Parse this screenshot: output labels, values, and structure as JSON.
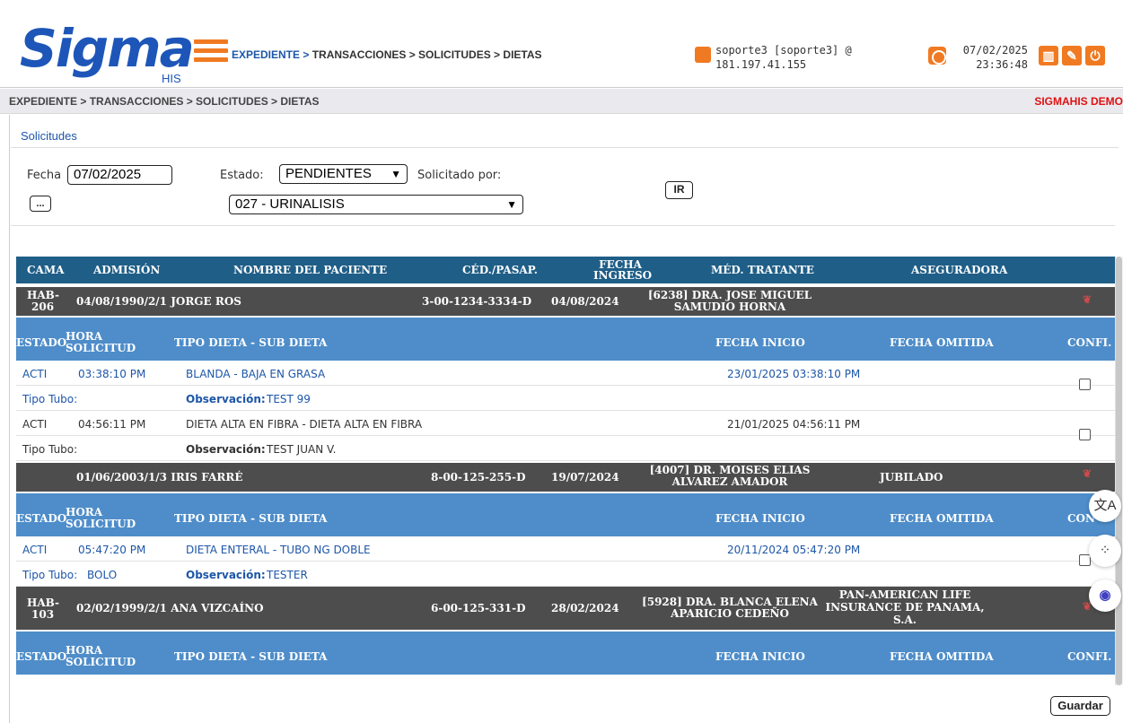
{
  "header": {
    "logo_text": "Sigma",
    "logo_sub": "HIS",
    "breadcrumb_prefix": "EXPEDIENTE > ",
    "breadcrumb_rest": "TRANSACCIONES > SOLICITUDES > DIETAS",
    "user_line1": "soporte3 [soporte3] @",
    "user_line2": "181.197.41.155",
    "date": "07/02/2025",
    "time": "23:36:48"
  },
  "subbar": {
    "breadcrumb": "EXPEDIENTE > TRANSACCIONES > SOLICITUDES > DIETAS",
    "demo_label": "SIGMAHIS DEMO"
  },
  "form": {
    "section_title": "Solicitudes",
    "fecha_label": "Fecha",
    "fecha_value": "07/02/2025",
    "dots_button": "...",
    "estado_label": "Estado:",
    "estado_value": "PENDIENTES",
    "solicitado_label": "Solicitado por:",
    "solicitado_value": "027 - URINALISIS",
    "ir_button": "IR"
  },
  "grid": {
    "headers": {
      "cama": "CAMA",
      "admision": "ADMISIÓN",
      "nombre": "NOMBRE DEL PACIENTE",
      "ced": "CÉD./PASAP.",
      "fecha_ingreso_1": "FECHA",
      "fecha_ingreso_2": "INGRESO",
      "medico": "MÉD. TRATANTE",
      "aseguradora": "ASEGURADORA"
    },
    "sub_headers": {
      "estado": "ESTADO",
      "hora_1": "HORA",
      "hora_2": "SOLICITUD",
      "tipo": "TIPO DIETA - SUB DIETA",
      "fecha_inicio": "FECHA INICIO",
      "fecha_omitida": "FECHA OMITIDA",
      "confirm_full": "CONFI.",
      "confirm_cut": "CON"
    },
    "tipo_tubo_label": "Tipo Tubo:",
    "observacion_label": "Observación:",
    "patients": [
      {
        "cama_1": "HAB-",
        "cama_2": "206",
        "admision_nombre": "04/08/1990/2/1 JORGE ROS",
        "ced": "3-00-1234-3334-D",
        "fecha_ingreso": "04/08/2024",
        "medico_1": "[6238] DRA. JOSE MIGUEL",
        "medico_2": "SAMUDIO HORNA",
        "aseguradora_1": "",
        "aseguradora_2": "",
        "aseguradora_3": "",
        "rows": [
          {
            "estado": "ACTI",
            "hora": "03:38:10 PM",
            "tipo": "BLANDA - BAJA EN GRASA",
            "fecha_inicio": "23/01/2025 03:38:10 PM",
            "tubo": "",
            "observacion": "TEST 99"
          },
          {
            "estado": "ACTI",
            "hora": "04:56:11 PM",
            "tipo": "DIETA ALTA EN FIBRA - DIETA ALTA EN FIBRA",
            "fecha_inicio": "21/01/2025 04:56:11 PM",
            "tubo": "",
            "observacion": "TEST JUAN V."
          }
        ]
      },
      {
        "cama_1": "",
        "cama_2": "",
        "admision_nombre": "01/06/2003/1/3 IRIS FARRÉ",
        "ced": "8-00-125-255-D",
        "fecha_ingreso": "19/07/2024",
        "medico_1": "[4007] DR. MOISES ELIAS",
        "medico_2": "ALVAREZ AMADOR",
        "aseguradora_1": "JUBILADO",
        "aseguradora_2": "",
        "aseguradora_3": "",
        "rows": [
          {
            "estado": "ACTI",
            "hora": "05:47:20 PM",
            "tipo": "DIETA ENTERAL - TUBO NG DOBLE",
            "fecha_inicio": "20/11/2024 05:47:20 PM",
            "tubo": "BOLO",
            "observacion": "TESTER"
          }
        ]
      },
      {
        "cama_1": "HAB-",
        "cama_2": "103",
        "admision_nombre": "02/02/1999/2/1 ANA VIZCAÍNO",
        "ced": "6-00-125-331-D",
        "fecha_ingreso": "28/02/2024",
        "medico_1": "[5928] DRA. BLANCA ELENA",
        "medico_2": "APARICIO CEDEÑO",
        "aseguradora_1": "PAN-AMERICAN LIFE",
        "aseguradora_2": "INSURANCE DE PANAMA,",
        "aseguradora_3": "S.A.",
        "rows": []
      }
    ]
  },
  "footer": {
    "save_button": "Guardar"
  },
  "colors": {
    "brand_blue": "#1d56b8",
    "accent_orange": "#f07a22",
    "grid_header": "#1f5e87",
    "patient_row": "#4d4d4d",
    "sub_header": "#4e8dc9",
    "demo_red": "#e01010"
  },
  "icons": [
    "menu-icon",
    "user-icon",
    "clock-icon",
    "reports-icon",
    "tools-icon",
    "power-icon",
    "favorite-icon",
    "translate-icon",
    "apps-icon",
    "assistant-icon"
  ]
}
